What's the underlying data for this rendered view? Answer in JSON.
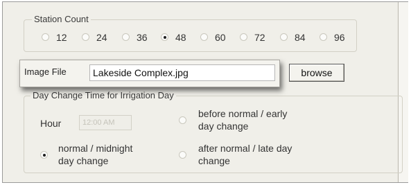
{
  "station_count": {
    "title": "Station Count",
    "options": [
      "12",
      "24",
      "36",
      "48",
      "60",
      "72",
      "84",
      "96"
    ],
    "selected": "48"
  },
  "image_file": {
    "label": "Image File",
    "value": "Lakeside Complex.jpg",
    "browse_label": "browse"
  },
  "day_change": {
    "title": "Day Change Time for Irrigation Day",
    "hour_label": "Hour",
    "hour_value": "12:00 AM",
    "options": {
      "early_line1": "before normal / early",
      "early_line2": "day change",
      "midnight_line1": "normal / midnight",
      "midnight_line2": "day change",
      "late_line1": "after normal / late day",
      "late_line2": "change"
    },
    "selected": "normal / midnight day change"
  }
}
